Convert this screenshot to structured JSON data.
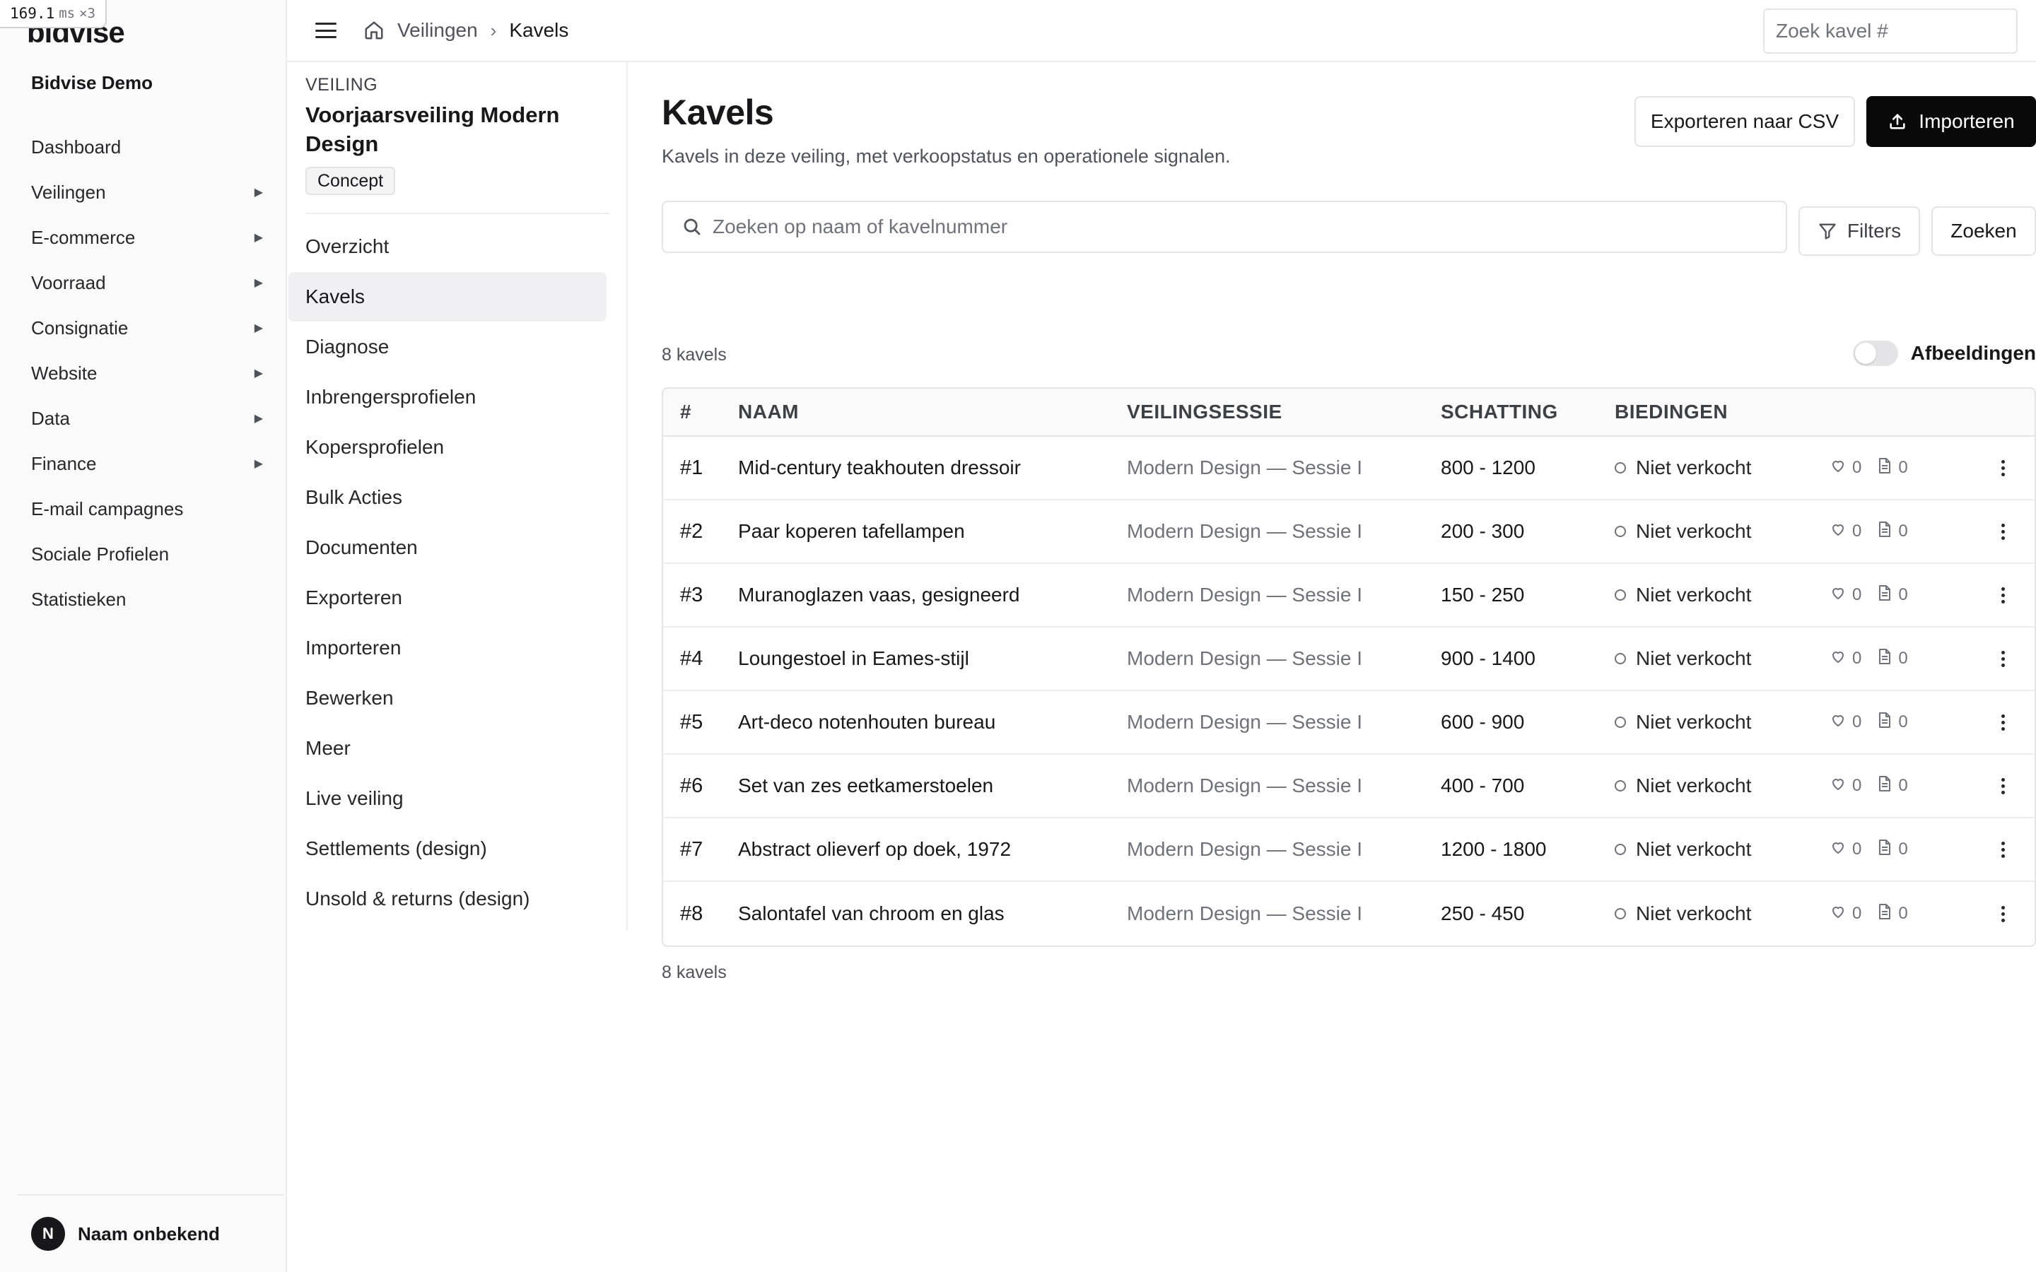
{
  "perf": {
    "value": "169.1",
    "unit": "ms",
    "multiplier": "×3"
  },
  "sidebar": {
    "logo": "bidvise",
    "org_name": "Bidvise Demo",
    "items": [
      {
        "label": "Dashboard",
        "expandable": false
      },
      {
        "label": "Veilingen",
        "expandable": true
      },
      {
        "label": "E-commerce",
        "expandable": true
      },
      {
        "label": "Voorraad",
        "expandable": true
      },
      {
        "label": "Consignatie",
        "expandable": true
      },
      {
        "label": "Website",
        "expandable": true
      },
      {
        "label": "Data",
        "expandable": true
      },
      {
        "label": "Finance",
        "expandable": true
      },
      {
        "label": "E-mail campagnes",
        "expandable": false
      },
      {
        "label": "Sociale Profielen",
        "expandable": false
      },
      {
        "label": "Statistieken",
        "expandable": false
      }
    ],
    "user": {
      "initial": "N",
      "name": "Naam onbekend"
    }
  },
  "topbar": {
    "breadcrumb": {
      "parent": "Veilingen",
      "separator": "›",
      "current": "Kavels"
    },
    "search_placeholder": "Zoek kavel #"
  },
  "auction": {
    "eyebrow": "VEILING",
    "title": "Voorjaarsveiling Modern Design",
    "status_badge": "Concept",
    "menu": [
      {
        "label": "Overzicht",
        "active": false
      },
      {
        "label": "Kavels",
        "active": true
      },
      {
        "label": "Diagnose",
        "active": false
      },
      {
        "label": "Inbrengersprofielen",
        "active": false
      },
      {
        "label": "Kopersprofielen",
        "active": false
      },
      {
        "label": "Bulk Acties",
        "active": false
      },
      {
        "label": "Documenten",
        "active": false
      },
      {
        "label": "Exporteren",
        "active": false
      },
      {
        "label": "Importeren",
        "active": false
      },
      {
        "label": "Bewerken",
        "active": false
      },
      {
        "label": "Meer",
        "active": false
      },
      {
        "label": "Live veiling",
        "active": false
      },
      {
        "label": "Settlements (design)",
        "active": false
      },
      {
        "label": "Unsold & returns (design)",
        "active": false
      }
    ]
  },
  "main": {
    "title": "Kavels",
    "subtitle": "Kavels in deze veiling, met verkoopstatus en operationele signalen.",
    "export_label": "Exporteren naar CSV",
    "import_label": "Importeren",
    "search_placeholder": "Zoeken op naam of kavelnummer",
    "filters_label": "Filters",
    "search_button": "Zoeken",
    "count_top": "8 kavels",
    "count_bottom": "8 kavels",
    "images_toggle": {
      "label": "Afbeeldingen",
      "on": false
    }
  },
  "table": {
    "columns": [
      "#",
      "NAAM",
      "VEILINGSESSIE",
      "SCHATTING",
      "BIEDINGEN"
    ],
    "rows": [
      {
        "num": "#1",
        "name": "Mid-century teakhouten dressoir",
        "session": "Modern Design — Sessie I",
        "estimate": "800 - 1200",
        "status": "Niet verkocht",
        "likes": "0",
        "docs": "0"
      },
      {
        "num": "#2",
        "name": "Paar koperen tafellampen",
        "session": "Modern Design — Sessie I",
        "estimate": "200 - 300",
        "status": "Niet verkocht",
        "likes": "0",
        "docs": "0"
      },
      {
        "num": "#3",
        "name": "Muranoglazen vaas, gesigneerd",
        "session": "Modern Design — Sessie I",
        "estimate": "150 - 250",
        "status": "Niet verkocht",
        "likes": "0",
        "docs": "0"
      },
      {
        "num": "#4",
        "name": "Loungestoel in Eames-stijl",
        "session": "Modern Design — Sessie I",
        "estimate": "900 - 1400",
        "status": "Niet verkocht",
        "likes": "0",
        "docs": "0"
      },
      {
        "num": "#5",
        "name": "Art-deco notenhouten bureau",
        "session": "Modern Design — Sessie I",
        "estimate": "600 - 900",
        "status": "Niet verkocht",
        "likes": "0",
        "docs": "0"
      },
      {
        "num": "#6",
        "name": "Set van zes eetkamerstoelen",
        "session": "Modern Design — Sessie I",
        "estimate": "400 - 700",
        "status": "Niet verkocht",
        "likes": "0",
        "docs": "0"
      },
      {
        "num": "#7",
        "name": "Abstract olieverf op doek, 1972",
        "session": "Modern Design — Sessie I",
        "estimate": "1200 - 1800",
        "status": "Niet verkocht",
        "likes": "0",
        "docs": "0"
      },
      {
        "num": "#8",
        "name": "Salontafel van chroom en glas",
        "session": "Modern Design — Sessie I",
        "estimate": "250 - 450",
        "status": "Niet verkocht",
        "likes": "0",
        "docs": "0"
      }
    ]
  },
  "colors": {
    "primary_button": "#0a0a0a",
    "active_nav": "#f0f0f2",
    "muted_text": "#71717a"
  },
  "icons": {
    "home": "home-icon",
    "search": "search-icon",
    "filter": "filter-icon",
    "upload": "upload-icon",
    "heart": "heart-icon",
    "doc": "document-icon",
    "more": "more-vertical-icon"
  }
}
